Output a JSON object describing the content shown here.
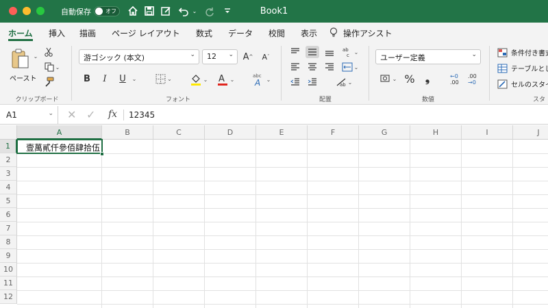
{
  "app": {
    "title": "Book1",
    "autosave_label": "自動保存",
    "autosave_state": "オフ",
    "accent_color": "#227447"
  },
  "tabs": [
    {
      "label": "ホーム",
      "active": true
    },
    {
      "label": "挿入"
    },
    {
      "label": "描画"
    },
    {
      "label": "ページ レイアウト"
    },
    {
      "label": "数式"
    },
    {
      "label": "データ"
    },
    {
      "label": "校閲"
    },
    {
      "label": "表示"
    },
    {
      "label": "操作アシスト"
    }
  ],
  "ribbon": {
    "clipboard": {
      "group_label": "クリップボード",
      "paste_label": "ペースト"
    },
    "font": {
      "group_label": "フォント",
      "font_name": "游ゴシック (本文)",
      "font_size": "12",
      "bold": "B",
      "italic": "I",
      "underline": "U"
    },
    "alignment": {
      "group_label": "配置"
    },
    "number": {
      "group_label": "数値",
      "format": "ユーザー定義",
      "percent": "%",
      "comma": "❟",
      "increase_decimal": "←0 .00",
      "decrease_decimal": ".00 →0"
    },
    "styles": {
      "group_label": "スタ",
      "items": [
        "条件付き書式",
        "テーブルとし",
        "セルのスタイ"
      ]
    }
  },
  "formula_bar": {
    "name_box": "A1",
    "fx": "fx",
    "content": "12345"
  },
  "sheet": {
    "columns": [
      "A",
      "B",
      "C",
      "D",
      "E",
      "F",
      "G",
      "H",
      "I",
      "J"
    ],
    "rows": [
      "1",
      "2",
      "3",
      "4",
      "5",
      "6",
      "7",
      "8",
      "9",
      "10",
      "11",
      "12"
    ],
    "active_cell": "A1",
    "cells": {
      "A1": "壹萬貳仟參佰肆拾伍"
    }
  }
}
